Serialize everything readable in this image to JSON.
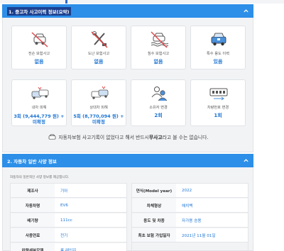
{
  "section1": {
    "title": "1. 중고차 사고이력 정보(요약)",
    "cards": [
      {
        "label": "전손 보험사고",
        "value": "없음",
        "icon": "car-crossed-icon"
      },
      {
        "label": "도난 보험사고",
        "value": "없음",
        "icon": "tools-crossed-icon"
      },
      {
        "label": "침수 보험사고",
        "value": "없음",
        "icon": "flooded-car-icon"
      },
      {
        "label": "특수 용도 이력",
        "value": "있음",
        "icon": "special-use-car-icon"
      },
      {
        "label": "내차 피해",
        "value": "3회 (9,444,779 원) +",
        "value2": "미확정",
        "icon": "my-car-damage-icon"
      },
      {
        "label": "상대차 피해",
        "value": "5회 (8,770,094 원) +",
        "value2": "미확정",
        "icon": "other-car-damage-icon"
      },
      {
        "label": "소유자 변경",
        "value": "2회",
        "icon": "owner-change-icon"
      },
      {
        "label": "차량번호 변경",
        "value": "1회",
        "icon": "plate-change-icon"
      }
    ],
    "notice": {
      "pre": "자동차보험 사고기록이 없었다고 해서 반드시 ",
      "bold": "무사고",
      "post": "라고 볼 수는 없습니다."
    }
  },
  "section2": {
    "title": "2. 자동차 일반 사양 정보",
    "note": "자동차의 일반적인 사양 정보를 제공합니다.",
    "left_rows": [
      {
        "key": "제조사",
        "value": "기아"
      },
      {
        "key": "자동차명",
        "value": "EV6"
      },
      {
        "key": "배기량",
        "value": "111cc"
      },
      {
        "key": "사용연료",
        "value": "전기"
      },
      {
        "key": "차량세부모델",
        "value": "롱 레인지"
      }
    ],
    "right_rows": [
      {
        "key": "연식(Model year)",
        "value": "2022"
      },
      {
        "key": "차체형상",
        "value": "해치백"
      },
      {
        "key": "용도 및 차종",
        "value": "자가용 승용"
      },
      {
        "key": "최초 보험 가입일자",
        "value": "2021년 11월 01일"
      }
    ]
  },
  "colors": {
    "header": "#2d8fe8",
    "accent": "#1c74d4",
    "panel": "#f2f3f5"
  }
}
